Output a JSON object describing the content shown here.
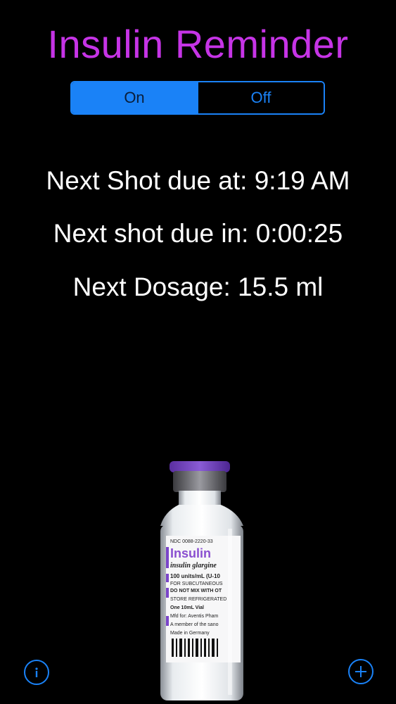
{
  "header": {
    "title": "Insulin Reminder"
  },
  "reminder_toggle": {
    "options": [
      "On",
      "Off"
    ],
    "selected": "On"
  },
  "status": {
    "next_shot_due_at": "Next Shot due at: 9:19 AM",
    "next_shot_due_in": "Next shot due in: 0:00:25",
    "next_dosage": "Next Dosage: 15.5 ml"
  },
  "vial_label": {
    "ndc": "NDC 0088-2220-33",
    "brand": "Insulin",
    "generic": "insulin glargine",
    "line1": "100 units/mL (U-10",
    "line2": "FOR SUBCUTANEOUS",
    "line3": "DO NOT MIX WITH OT",
    "line4": "STORE REFRIGERATED",
    "line5": "One 10mL Vial",
    "line6": "Mfd for: Aventis Pham",
    "line7": "A member of the sano",
    "line8": "Made in Germany"
  },
  "toolbar": {
    "info_icon": "info-icon",
    "add_icon": "plus-icon"
  },
  "colors": {
    "title": "#c634e6",
    "accent": "#1a82f7",
    "background": "#000000",
    "text": "#ffffff"
  }
}
